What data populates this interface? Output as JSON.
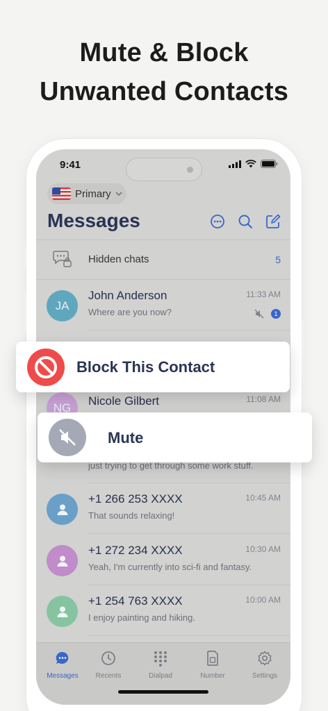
{
  "headline": {
    "line1": "Mute & Block",
    "line2": "Unwanted Contacts"
  },
  "status": {
    "time": "9:41"
  },
  "account": {
    "label": "Primary"
  },
  "title": "Messages",
  "hidden_chats": {
    "label": "Hidden chats",
    "count": "5"
  },
  "conversations": [
    {
      "name": "John Anderson",
      "snippet": "Where are you now?",
      "time": "11:33 AM",
      "initials": "JA",
      "avatar_color": "#5fa7bd",
      "muted": true,
      "unread": "1"
    },
    {
      "name": "Nicole Gilbert",
      "snippet": "",
      "time": "11:08 AM",
      "initials": "NG",
      "avatar_color": "#c9a2d6"
    },
    {
      "name": "",
      "snippet": "just trying to get through some work stuff.",
      "time": "",
      "avatar_color": "#9cc9b0"
    },
    {
      "name": "+1 266 253 XXXX",
      "snippet": "That sounds relaxing!",
      "time": "10:45 AM",
      "avatar_color": "#6a9fc8"
    },
    {
      "name": "+1 272 234 XXXX",
      "snippet": "Yeah, I'm currently into sci-fi and fantasy.",
      "time": "10:30 AM",
      "avatar_color": "#c08cc9"
    },
    {
      "name": "+1 254 763 XXXX",
      "snippet": "I enjoy painting and hiking.",
      "time": "10:00 AM",
      "avatar_color": "#86c4a1"
    }
  ],
  "actions": {
    "block": "Block This Contact",
    "mute": "Mute"
  },
  "tabs": [
    {
      "label": "Messages",
      "icon": "chat-bubble-icon",
      "active": true
    },
    {
      "label": "Recents",
      "icon": "clock-icon"
    },
    {
      "label": "Dialpad",
      "icon": "dialpad-icon"
    },
    {
      "label": "Number",
      "icon": "sim-card-icon"
    },
    {
      "label": "Settings",
      "icon": "gear-icon"
    }
  ],
  "colors": {
    "accent": "#3a66c8",
    "block_red": "#ef4b4b",
    "title_navy": "#2a3454"
  }
}
